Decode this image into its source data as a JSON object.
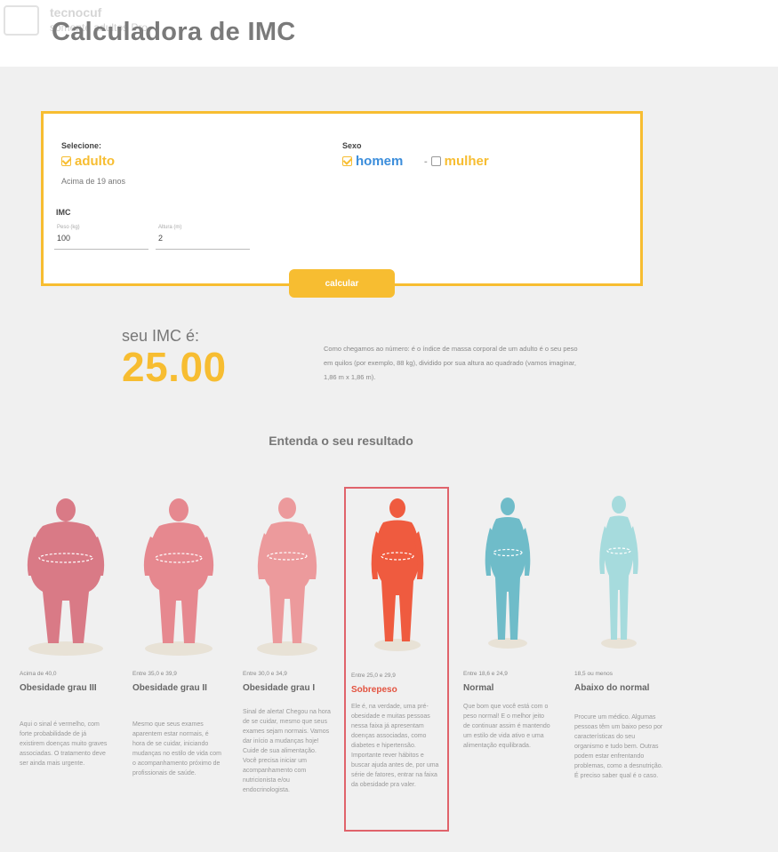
{
  "header": {
    "brand_top": "tecnocuf",
    "brand_sub": "somente adultos Pro",
    "title": "Calculadora de IMC"
  },
  "form": {
    "select_label": "Selecione:",
    "group_option": "adulto",
    "group_note": "Acima de 19 anos",
    "sex_label": "Sexo",
    "sex_options": [
      "homem",
      "mulher"
    ],
    "imc_label": "IMC",
    "weight_placeholder": "Peso (kg)",
    "weight_value": "100",
    "height_placeholder": "Altura (m)",
    "height_value": "2",
    "calculate_label": "calcular"
  },
  "result": {
    "label": "seu IMC é:",
    "value": "25.00",
    "description": "Como chegamos ao número: é o índice de massa corporal de um adulto é o seu peso em quilos (por exemplo, 88 kg), dividido por sua altura ao quadrado (vamos imaginar, 1,86 m x 1,86 m)."
  },
  "section_title": "Entenda o seu resultado",
  "categories": [
    {
      "range": "Acima de 40,0",
      "name": "Obesidade grau III",
      "desc": "Aqui o sinal é vermelho, com forte probabilidade de já existirem doenças muito graves associadas. O tratamento deve ser ainda mais urgente.",
      "color": "#d97a86"
    },
    {
      "range": "Entre 35,0 e 39,9",
      "name": "Obesidade grau II",
      "desc": "Mesmo que seus exames aparentem estar normais, é hora de se cuidar, iniciando mudanças no estilo de vida com o acompanhamento próximo de profissionais de saúde.",
      "color": "#e6888f"
    },
    {
      "range": "Entre 30,0 e 34,9",
      "name": "Obesidade grau I",
      "desc": "Sinal de alerta! Chegou na hora de se cuidar, mesmo que seus exames sejam normais. Vamos dar início a mudanças hoje! Cuide de sua alimentação. Você precisa iniciar um acompanhamento com nutricionista e/ou endocrinologista.",
      "color": "#ec9a9c"
    },
    {
      "range": "Entre 25,0 e 29,9",
      "name": "Sobrepeso",
      "desc": "Ele é, na verdade, uma pré-obesidade e muitas pessoas nessa faixa já apresentam doenças associadas, como diabetes e hipertensão. Importante rever hábitos e buscar ajuda antes de, por uma série de fatores, entrar na faixa da obesidade pra valer.",
      "color": "#ef5b3f"
    },
    {
      "range": "Entre 18,6 e 24,9",
      "name": "Normal",
      "desc": "Que bom que você está com o peso normal! E o melhor jeito de continuar assim é mantendo um estilo de vida ativo e uma alimentação equilibrada.",
      "color": "#6fbcc9"
    },
    {
      "range": "18,5 ou menos",
      "name": "Abaixo do normal",
      "desc": "Procure um médico. Algumas pessoas têm um baixo peso por características do seu organismo e tudo bem. Outras podem estar enfrentando problemas, como a desnutrição. É preciso saber qual é o caso.",
      "color": "#a6dbdd"
    }
  ],
  "colors": {
    "accent": "#f7bd31",
    "blue": "#3b8ddb",
    "selected_border": "#e0636b",
    "selected_text": "#e3523f"
  }
}
